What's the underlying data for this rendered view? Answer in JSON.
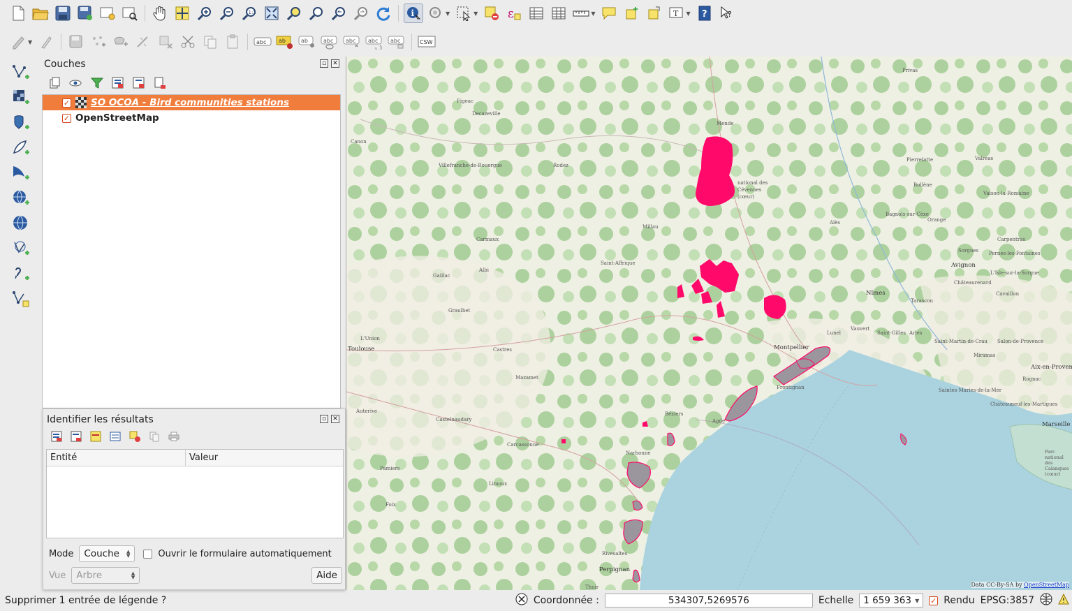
{
  "toolbar1": {
    "buttons": [
      "new-project",
      "open-project",
      "save-project",
      "save-as",
      "new-print-composer",
      "composer-manager",
      "pan",
      "pan-to-selection",
      "zoom-in",
      "zoom-out",
      "zoom-actual",
      "zoom-full",
      "zoom-to-selection",
      "zoom-to-layer",
      "zoom-last",
      "zoom-next",
      "refresh",
      "identify",
      "select",
      "deselect",
      "open-attribute-table",
      "statistics",
      "measure",
      "map-tips",
      "new-bookmark",
      "show-bookmarks",
      "text-annotation",
      "help",
      "whats-this"
    ]
  },
  "toolbar2": {
    "csw_label": "CSW",
    "abc_label": "abc",
    "ab_label": "ab"
  },
  "layers_panel": {
    "title": "Couches",
    "layers": [
      {
        "name": "SO OCOA - Bird communities stations",
        "checked": true,
        "selected": true
      },
      {
        "name": "OpenStreetMap",
        "checked": true,
        "selected": false
      }
    ]
  },
  "identify_panel": {
    "title": "Identifier les résultats",
    "columns": [
      "Entité",
      "Valeur"
    ],
    "mode_label": "Mode",
    "mode_value": "Couche",
    "auto_open_label": "Ouvrir le formulaire automatiquement",
    "view_label": "Vue",
    "view_value": "Arbre",
    "help_label": "Aide"
  },
  "map": {
    "attribution_text": "Data CC-By-SA by",
    "attribution_link": "OpenStreetMap",
    "labels": [
      {
        "text": "Mende",
        "big": false
      },
      {
        "text": "Millau",
        "big": false
      },
      {
        "text": "Rodez",
        "big": false
      },
      {
        "text": "Decazeville",
        "big": false
      },
      {
        "text": "Figeac",
        "big": false
      },
      {
        "text": "Villefranche-de-Rouergue",
        "big": false
      },
      {
        "text": "Carmaux",
        "big": false
      },
      {
        "text": "Albi",
        "big": false
      },
      {
        "text": "Gaillac",
        "big": false
      },
      {
        "text": "Saint-Affrique",
        "big": false
      },
      {
        "text": "Graulhet",
        "big": false
      },
      {
        "text": "L'Union",
        "big": false
      },
      {
        "text": "Toulouse",
        "big": true
      },
      {
        "text": "Castres",
        "big": false
      },
      {
        "text": "Mazamet",
        "big": false
      },
      {
        "text": "Castelnaudary",
        "big": false
      },
      {
        "text": "Carcassonne",
        "big": false
      },
      {
        "text": "Auterive",
        "big": false
      },
      {
        "text": "Pamiers",
        "big": false
      },
      {
        "text": "Limoux",
        "big": false
      },
      {
        "text": "Foix",
        "big": false
      },
      {
        "text": "Narbonne",
        "big": false
      },
      {
        "text": "Béziers",
        "big": false
      },
      {
        "text": "Agde",
        "big": false
      },
      {
        "text": "Perpignan",
        "big": true
      },
      {
        "text": "Rivesaltes",
        "big": false
      },
      {
        "text": "Thuir",
        "big": false
      },
      {
        "text": "Montpellier",
        "big": true
      },
      {
        "text": "Lunel",
        "big": false
      },
      {
        "text": "Frontignan",
        "big": false
      },
      {
        "text": "Nîmes",
        "big": true
      },
      {
        "text": "Vauvert",
        "big": false
      },
      {
        "text": "Saint-Gilles",
        "big": false
      },
      {
        "text": "Arles",
        "big": false
      },
      {
        "text": "Tarascon",
        "big": false
      },
      {
        "text": "Alès",
        "big": false
      },
      {
        "text": "Bagnols-sur-Cèze",
        "big": false
      },
      {
        "text": "Orange",
        "big": false
      },
      {
        "text": "Avignon",
        "big": true
      },
      {
        "text": "Carpentras",
        "big": false
      },
      {
        "text": "Sorgues",
        "big": false
      },
      {
        "text": "Pernes-les-Fontaines",
        "big": false
      },
      {
        "text": "L'Isle-sur-la-Sorgue",
        "big": false
      },
      {
        "text": "Châteaurenard",
        "big": false
      },
      {
        "text": "Cavaillon",
        "big": false
      },
      {
        "text": "Vaison-la-Romaine",
        "big": false
      },
      {
        "text": "Bollène",
        "big": false
      },
      {
        "text": "Pierrelatte",
        "big": false
      },
      {
        "text": "Valréas",
        "big": false
      },
      {
        "text": "Privas",
        "big": false
      },
      {
        "text": "Saint-Martin-de-Crau",
        "big": false
      },
      {
        "text": "Salon-de-Provence",
        "big": false
      },
      {
        "text": "Miramas",
        "big": false
      },
      {
        "text": "Aix-en-Provence",
        "big": true
      },
      {
        "text": "Rognac",
        "big": false
      },
      {
        "text": "Saintes-Maries-de-la-Mer",
        "big": false
      },
      {
        "text": "Châteauneuf-les-Martigues",
        "big": false
      },
      {
        "text": "Marseille",
        "big": true
      },
      {
        "text": "Canon",
        "big": false
      },
      {
        "text": "national des Cévennes (cœur)",
        "big": false
      },
      {
        "text": "Parc national des Calanques (cœur)",
        "big": false
      }
    ]
  },
  "statusbar": {
    "message": "Supprimer 1 entrée de légende ?",
    "coord_label": "Coordonnée :",
    "coord_value": "534307,5269576",
    "scale_label": "Echelle",
    "scale_value": "1 659 363",
    "render_label": "Rendu",
    "crs": "EPSG:3857"
  },
  "colors": {
    "selection_orange": "#f07d3b",
    "station_pink": "#ff0a6a",
    "lagoon_gray": "#9b969d",
    "sea": "#aad3df",
    "forest": "#add19e"
  }
}
